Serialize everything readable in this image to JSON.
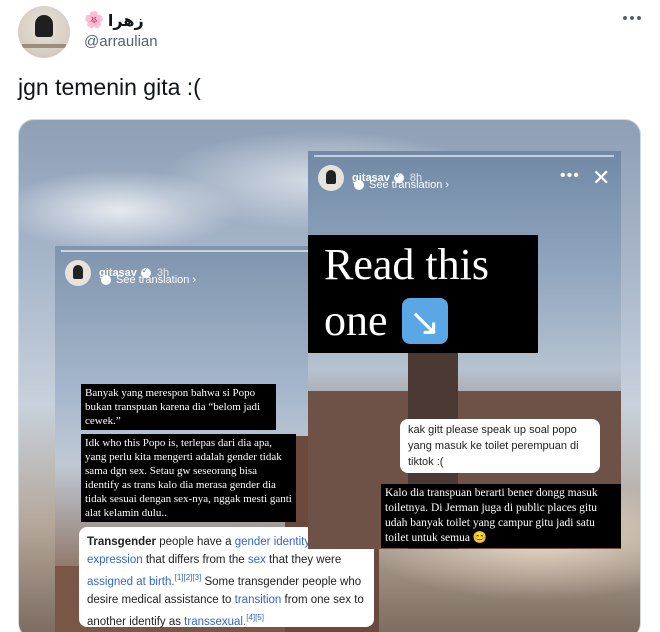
{
  "author": {
    "display_name": "زهرا",
    "flower": "🌸",
    "handle": "@arraulian"
  },
  "tweet": {
    "text": "jgn temenin gita :("
  },
  "story_left": {
    "username": "gitasav",
    "time": "3h",
    "see_translation": "See translation ›",
    "box1": "Banyak yang merespon bahwa si Popo bukan transpuan karena dia “belom jadi cewek.”",
    "box2": "Idk who this Popo is, terlepas dari dia apa, yang perlu kita mengerti adalah gender tidak sama dgn sex. Setau gw seseorang bisa identify as trans kalo dia merasa gender dia tidak sesuai dengan sex-nya, nggak mesti ganti alat kelamin dulu..",
    "wiki": {
      "bold_term": "Transgender",
      "t1": " people have a ",
      "link1": "gender identity",
      "t2": " or ",
      "link2": "gender expression",
      "t3": " that differs from the ",
      "link3": "sex",
      "t4": " that they were ",
      "link4": "assigned at birth.",
      "sup1": "[1][2][3]",
      "t5": " Some transgender people who desire medical assistance to ",
      "link5": "transition",
      "t6": " from one sex to another identify as ",
      "link6": "transsexual.",
      "sup2": "[4][5]"
    }
  },
  "story_right": {
    "username": "gitasav",
    "time": "8h",
    "see_translation": "See translation ›",
    "more": "•••",
    "close": "✕",
    "headline_line1": "Read this",
    "headline_line2": "one",
    "dm": "kak gitt please speak up soal popo yang masuk ke toilet perempuan di tiktok :(",
    "reply": "Kalo dia transpuan berarti bener dongg masuk toiletnya. Di Jerman juga di public places gitu udah banyak toilet yang campur gitu jadi satu toilet untuk semua 😊"
  }
}
